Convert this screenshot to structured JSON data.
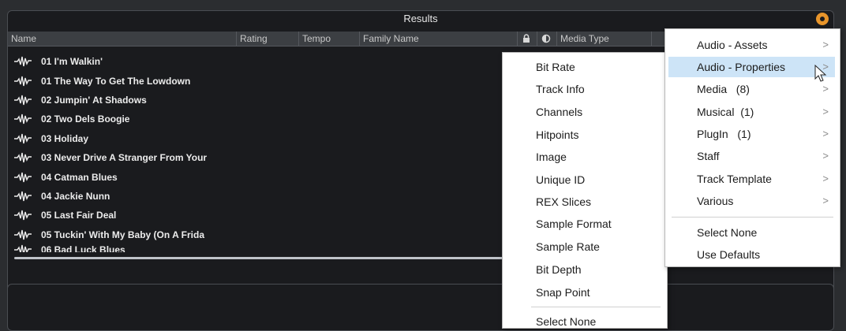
{
  "results": {
    "title": "Results",
    "columns": [
      "Name",
      "Rating",
      "Tempo",
      "Family Name",
      "Media Type"
    ],
    "rows": [
      "01 I'm Walkin'",
      "01 The Way To Get The Lowdown",
      "02 Jumpin' At Shadows",
      "02 Two Dels Boogie",
      "03 Holiday",
      "03 Never Drive A Stranger From Your",
      "04 Catman Blues",
      "04 Jackie Nunn",
      "05 Last Fair Deal",
      "05 Tuckin' With My Baby (On A Frida",
      "06 Bad Luck Blues"
    ]
  },
  "submenu": {
    "items": [
      "Bit Rate",
      "Track Info",
      "Channels",
      "Hitpoints",
      "Image",
      "Unique ID",
      "REX Slices",
      "Sample Format",
      "Sample Rate",
      "Bit Depth",
      "Snap Point"
    ],
    "select_none": "Select None"
  },
  "mainmenu": {
    "items": [
      {
        "label": "Audio - Assets",
        "highlighted": false
      },
      {
        "label": "Audio - Properties",
        "highlighted": true
      },
      {
        "label": "Media   (8)",
        "highlighted": false
      },
      {
        "label": "Musical  (1)",
        "highlighted": false
      },
      {
        "label": "PlugIn   (1)",
        "highlighted": false
      },
      {
        "label": "Staff",
        "highlighted": false
      },
      {
        "label": "Track Template",
        "highlighted": false
      },
      {
        "label": "Various",
        "highlighted": false
      }
    ],
    "chevron": ">",
    "select_none": "Select None",
    "use_defaults": "Use Defaults"
  },
  "colors": {
    "accent": "#e8952b",
    "highlight": "#cde4f7"
  },
  "icons": {
    "audio-file": "waveform-icon",
    "lock": "lock-icon",
    "contrast": "half-circle-icon",
    "settings": "gear-icon"
  }
}
